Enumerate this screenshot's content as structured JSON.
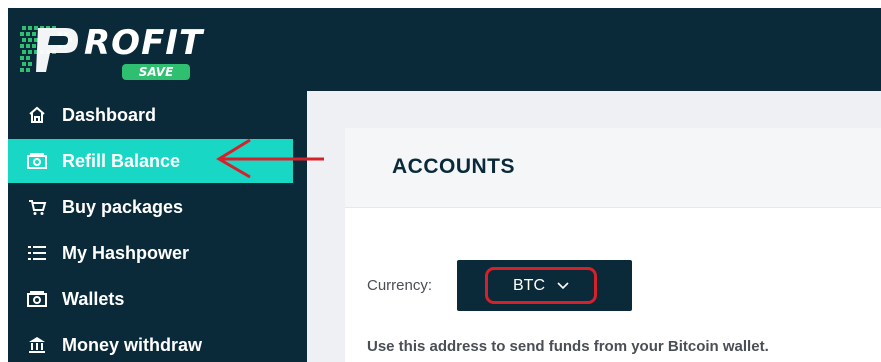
{
  "brand": {
    "name": "ROFIT",
    "tag": "SAVE"
  },
  "sidebar": {
    "items": [
      {
        "label": "Dashboard",
        "icon": "home-icon"
      },
      {
        "label": "Refill Balance",
        "icon": "cash-icon"
      },
      {
        "label": "Buy packages",
        "icon": "cart-icon"
      },
      {
        "label": "My Hashpower",
        "icon": "list-icon"
      },
      {
        "label": "Wallets",
        "icon": "wallet-icon"
      },
      {
        "label": "Money withdraw",
        "icon": "bank-icon"
      }
    ],
    "active_index": 1
  },
  "main": {
    "title": "ACCOUNTS",
    "currency_label": "Currency:",
    "currency_value": "BTC",
    "note": "Use this address to send funds from your Bitcoin wallet."
  },
  "colors": {
    "sidebar_bg": "#0a2a3a",
    "active_bg": "#18d7c5",
    "annotation_red": "#d6212a",
    "brand_green": "#2fbf71"
  }
}
